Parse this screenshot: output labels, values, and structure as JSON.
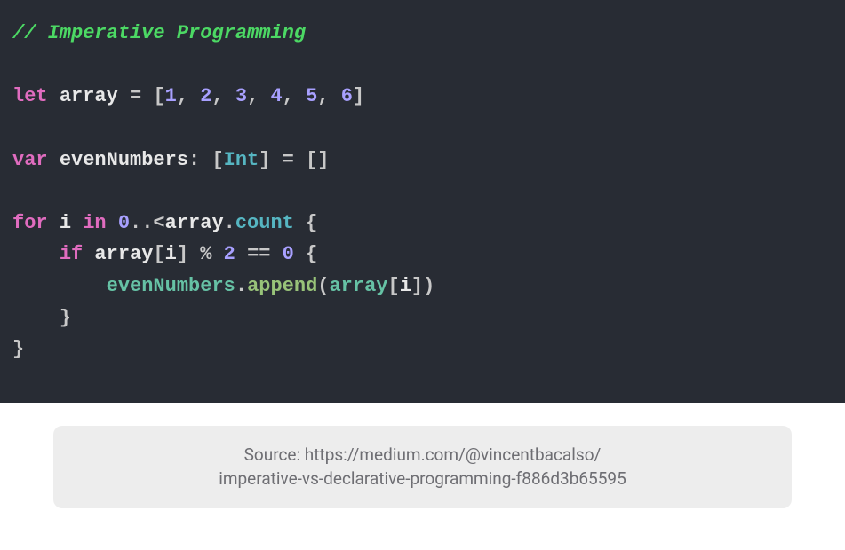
{
  "code": {
    "comment": "// Imperative Programming",
    "kw_let": "let",
    "arr_name": "array",
    "eq": "=",
    "lbrack": "[",
    "rbrack": "]",
    "nums": [
      "1",
      "2",
      "3",
      "4",
      "5",
      "6"
    ],
    "comma": ",",
    "kw_var": "var",
    "even_name": "evenNumbers",
    "colon": ":",
    "type_int": "Int",
    "kw_for": "for",
    "i_name": "i",
    "kw_in": "in",
    "zero": "0",
    "range": "..<",
    "dot": ".",
    "count": "count",
    "lbrace": "{",
    "rbrace": "}",
    "kw_if": "if",
    "mod": "%",
    "two": "2",
    "eqeq": "==",
    "append": "append",
    "lparen": "(",
    "rparen": ")"
  },
  "caption": {
    "line1": "Source: https://medium.com/@vincentbacalso/",
    "line2": "imperative-vs-declarative-programming-f886d3b65595"
  }
}
